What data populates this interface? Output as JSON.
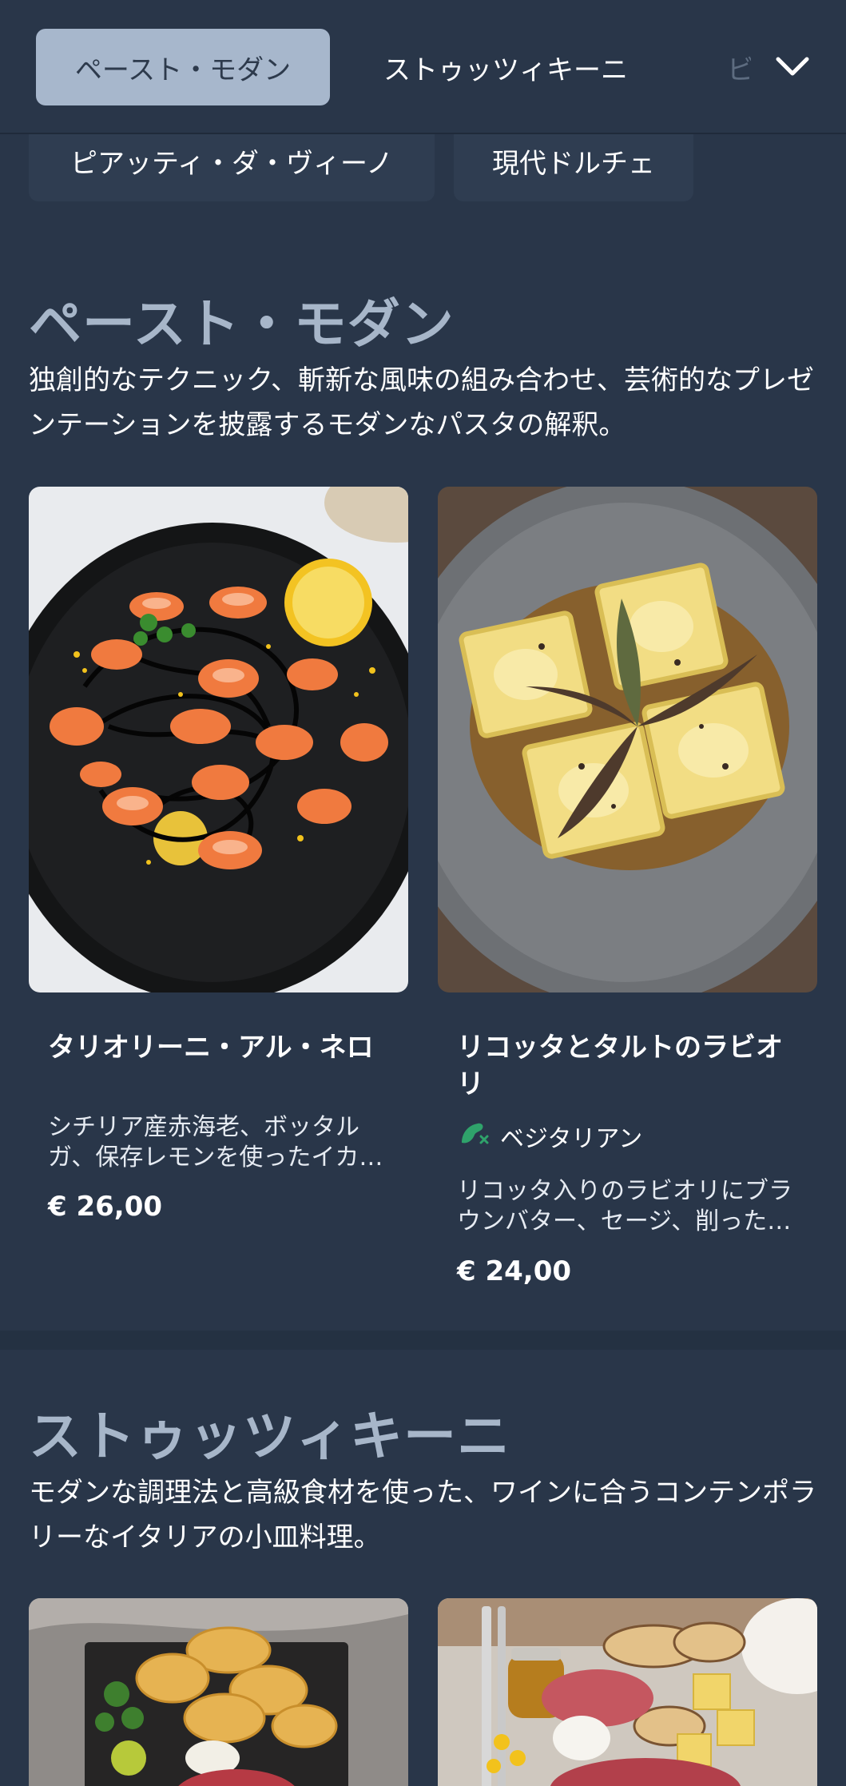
{
  "tabs": {
    "active": "ペースト・モダン",
    "second": "ストゥッツィキーニ",
    "third_partial": "ビ"
  },
  "chips": [
    "ピアッティ・ダ・ヴィーノ",
    "現代ドルチェ"
  ],
  "sections": [
    {
      "title": "ペースト・モダン",
      "description": "独創的なテクニック、斬新な風味の組み合わせ、芸術的なプレゼンテーションを披露するモダンなパスタの解釈。",
      "items": [
        {
          "name": "タリオリーニ・アル・ネロ",
          "description": "シチリア産赤海老、ボッタルガ、保存レモンを使ったイカ墨タリオリーニ",
          "price": "€ 26,00"
        },
        {
          "name": "リコッタとタルトのラビオリ",
          "badge": "ベジタリアン",
          "description": "リコッタ入りのラビオリにブラウンバター、セージ、削ったトリュフ",
          "price": "€ 24,00"
        }
      ]
    },
    {
      "title": "ストゥッツィキーニ",
      "description": "モダンな調理法と高級食材を使った、ワインに合うコンテンポラリーなイタリアの小皿料理。"
    }
  ],
  "colors": {
    "background": "#293649",
    "tab_active_bg": "#a7b7cc",
    "section_title": "#a7b6c9",
    "vegetarian_icon": "#2fa36b"
  }
}
